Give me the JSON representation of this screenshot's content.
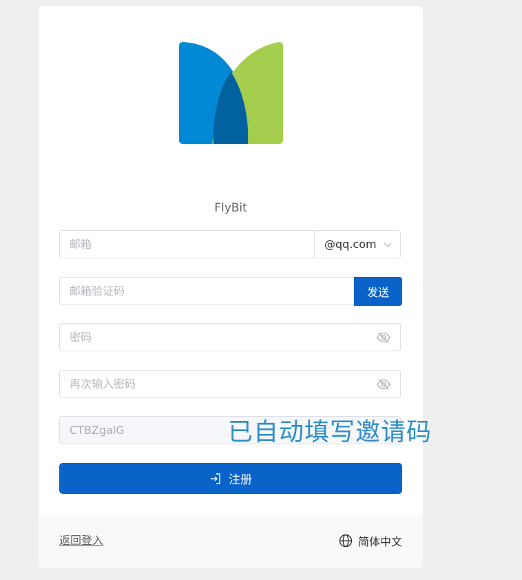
{
  "app": {
    "name": "FlyBit"
  },
  "form": {
    "email": {
      "placeholder": "邮箱",
      "value": ""
    },
    "email_domain": {
      "selected": "@qq.com"
    },
    "verify_code": {
      "placeholder": "邮箱验证码",
      "value": ""
    },
    "send_button": "发送",
    "password": {
      "placeholder": "密码",
      "value": ""
    },
    "password_confirm": {
      "placeholder": "再次输入密码",
      "value": ""
    },
    "invite_code": {
      "value": "CTBZgalG"
    },
    "register_button": "注册"
  },
  "footer": {
    "back_to_login": "返回登入",
    "language": "简体中文"
  },
  "annotation": {
    "text": "已自动填写邀请码"
  },
  "colors": {
    "primary": "#0a63c9",
    "logo_blue": "#0189d5",
    "logo_green": "#a6ce4e",
    "logo_dark_blue": "#02629f",
    "annotation": "#2e8ec9"
  },
  "icons": {
    "logo": "flybit-logo",
    "domain_dropdown": "chevron-down-icon",
    "password_toggle": "eye-off-icon",
    "register": "login-arrow-icon",
    "language": "globe-icon"
  }
}
